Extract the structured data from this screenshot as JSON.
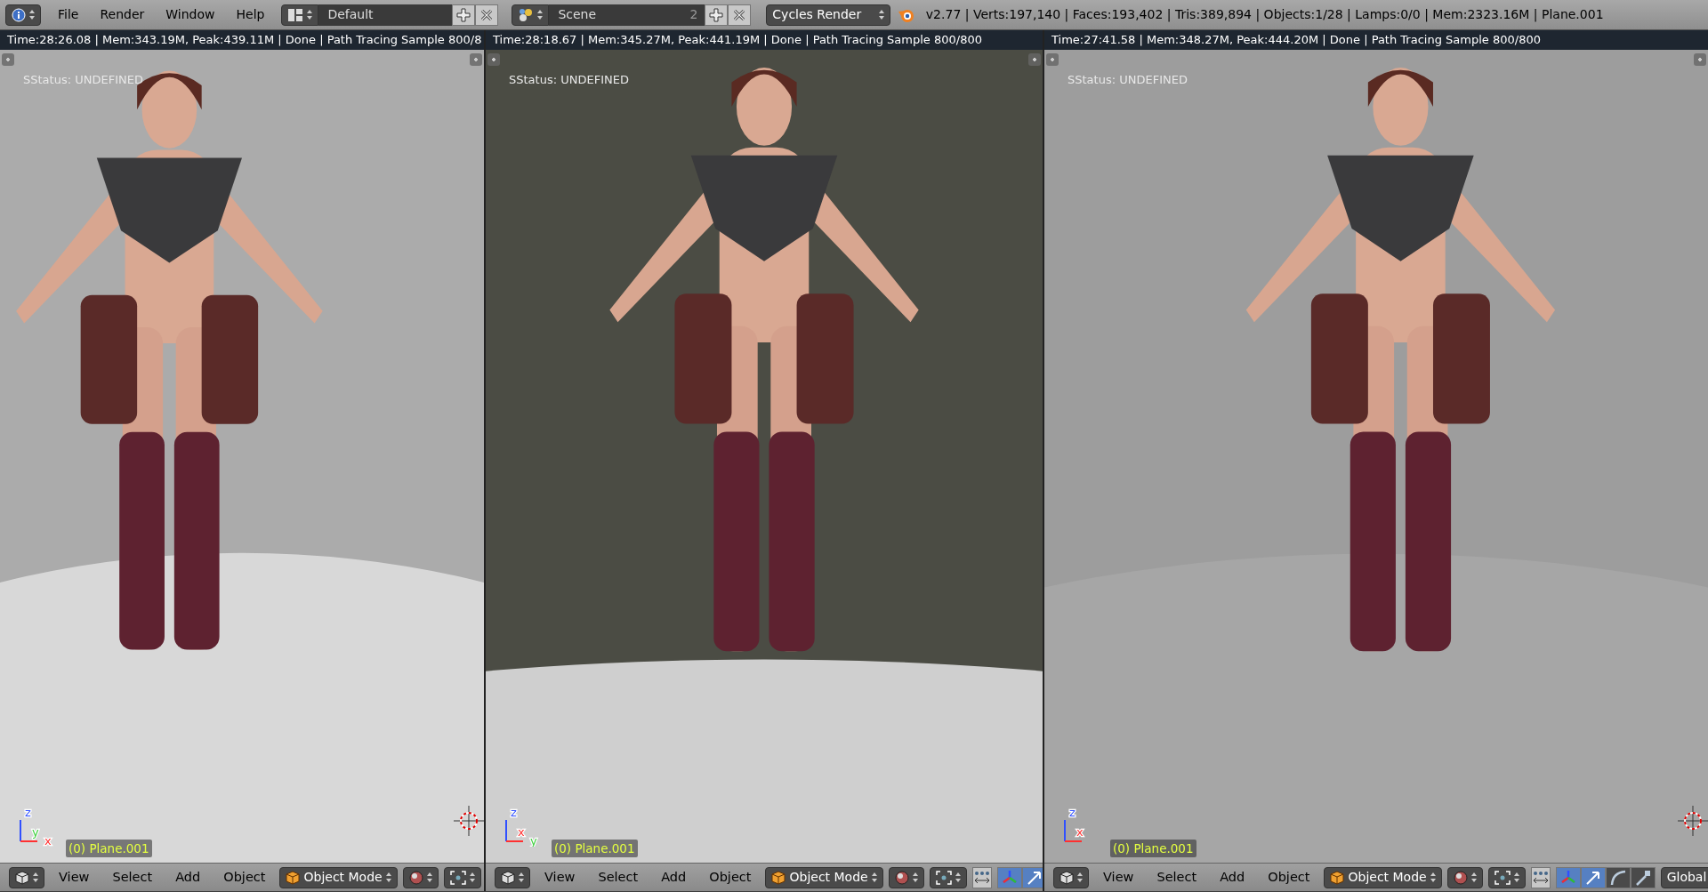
{
  "top_bar": {
    "menus": [
      "File",
      "Render",
      "Window",
      "Help"
    ],
    "screen_layout": "Default",
    "scene": "Scene",
    "scene_users": "2",
    "render_engine": "Cycles Render",
    "stats": "v2.77 | Verts:197,140 | Faces:193,402 | Tris:389,894 | Objects:1/28 | Lamps:0/0 | Mem:2323.16M | Plane.001"
  },
  "viewports": [
    {
      "render_info": "Time:28:26.08 | Mem:343.19M, Peak:439.11M | Done | Path Tracing Sample 800/8",
      "status": "SStatus: UNDEFINED",
      "object_label": "(0) Plane.001",
      "axes": [
        {
          "label": "z",
          "color": "#3050ff"
        },
        {
          "label": "y",
          "color": "#40d040"
        },
        {
          "label": "x",
          "color": "#ff3030"
        }
      ],
      "menus": [
        "View",
        "Select",
        "Add",
        "Object"
      ],
      "mode": "Object Mode"
    },
    {
      "render_info": "Time:28:18.67 | Mem:345.27M, Peak:441.19M | Done | Path Tracing Sample 800/800",
      "status": "SStatus: UNDEFINED",
      "object_label": "(0) Plane.001",
      "axes": [
        {
          "label": "z",
          "color": "#3050ff"
        },
        {
          "label": "x",
          "color": "#ff3030"
        },
        {
          "label": "y",
          "color": "#40d040"
        }
      ],
      "menus": [
        "View",
        "Select",
        "Add",
        "Object"
      ],
      "mode": "Object Mode"
    },
    {
      "render_info": "Time:27:41.58 | Mem:348.27M, Peak:444.20M | Done | Path Tracing Sample 800/800",
      "status": "SStatus: UNDEFINED",
      "object_label": "(0) Plane.001",
      "axes": [
        {
          "label": "z",
          "color": "#3050ff"
        },
        {
          "label": "x",
          "color": "#ff3030"
        }
      ],
      "menus": [
        "View",
        "Select",
        "Add",
        "Object"
      ],
      "mode": "Object Mode",
      "orientation": "Global"
    }
  ]
}
